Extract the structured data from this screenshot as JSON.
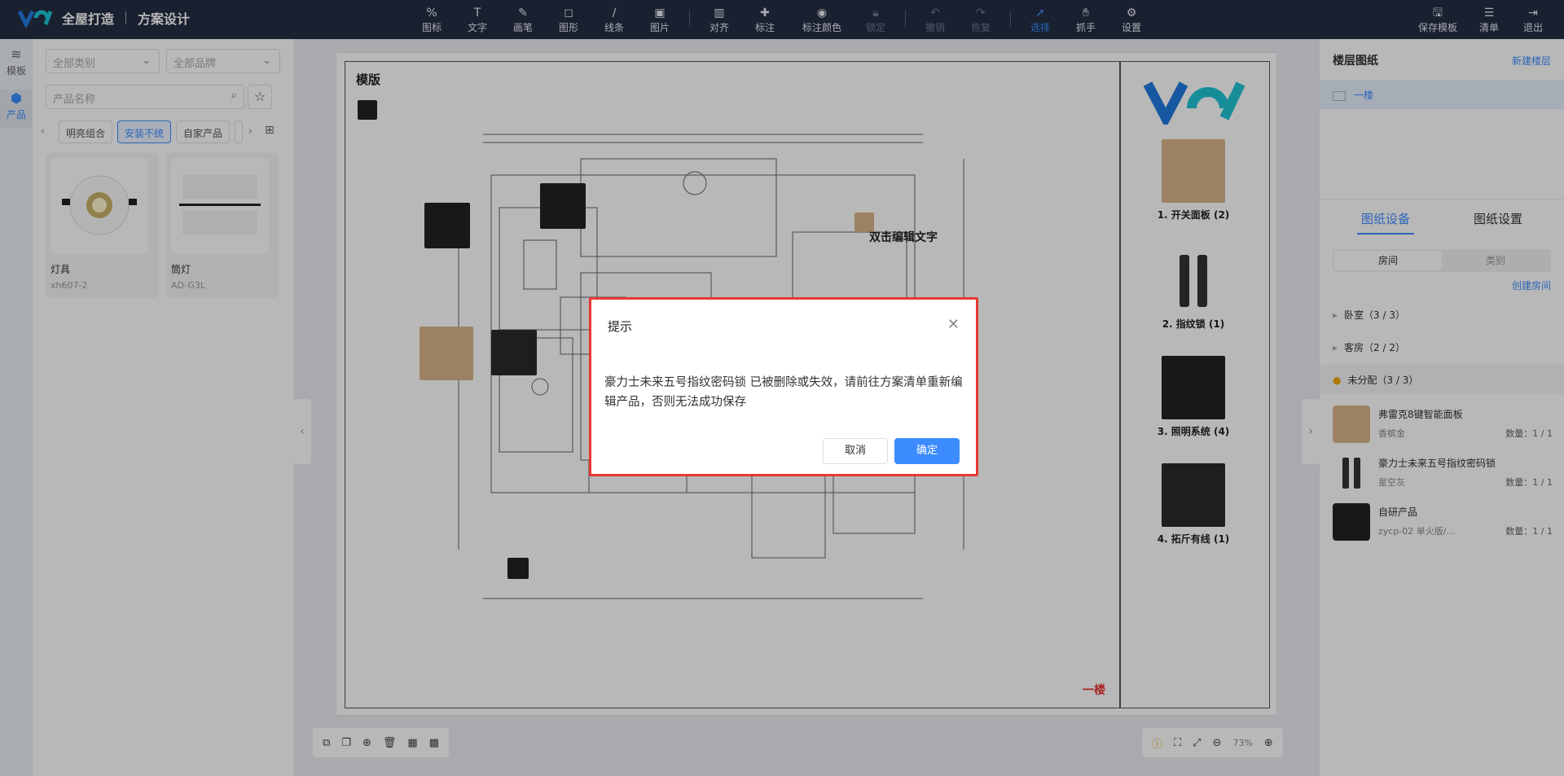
{
  "header": {
    "brand_title": "全屋打造",
    "brand_subtitle": "方案设计",
    "tools": [
      {
        "label": "图标",
        "icon": "percent-icon"
      },
      {
        "label": "文字",
        "icon": "text-icon"
      },
      {
        "label": "画笔",
        "icon": "brush-icon"
      },
      {
        "label": "图形",
        "icon": "shape-icon"
      },
      {
        "label": "线条",
        "icon": "line-icon"
      },
      {
        "label": "图片",
        "icon": "image-icon"
      },
      {
        "label": "对齐",
        "icon": "align-icon"
      },
      {
        "label": "标注",
        "icon": "pin-icon"
      },
      {
        "label": "标注颜色",
        "icon": "palette-icon"
      },
      {
        "label": "锁定",
        "icon": "lock-icon"
      },
      {
        "label": "撤销",
        "icon": "undo-icon"
      },
      {
        "label": "恢复",
        "icon": "redo-icon"
      },
      {
        "label": "选择",
        "icon": "cursor-icon"
      },
      {
        "label": "抓手",
        "icon": "hand-icon"
      },
      {
        "label": "设置",
        "icon": "gear-icon"
      }
    ],
    "save_template": "保存模板",
    "list": "清单",
    "exit": "退出"
  },
  "rail": {
    "templates": "模板",
    "products": "产品"
  },
  "left": {
    "category_placeholder": "全部类别",
    "brand_placeholder": "全部品牌",
    "search_placeholder": "产品名称",
    "tags": [
      "明亮组合",
      "安装不统",
      "自家产品"
    ],
    "cards": [
      {
        "name": "灯具",
        "sku": "xh607-2"
      },
      {
        "name": "筒灯",
        "sku": "AD-G3L"
      }
    ]
  },
  "canvas": {
    "title": "模版",
    "edit_text": "双击编辑文字",
    "floor_label": "一楼",
    "legend": [
      {
        "label": "1. 开关面板 (2)"
      },
      {
        "label": "2. 指纹锁 (1)"
      },
      {
        "label": "3. 照明系统 (4)"
      },
      {
        "label": "4. 拓斤有线 (1)"
      }
    ],
    "zoom": "73%"
  },
  "right": {
    "floor_plans_title": "楼层图纸",
    "new_floor": "新建楼层",
    "floor_item": "一楼",
    "tab_devices": "图纸设备",
    "tab_settings": "图纸设置",
    "seg_room": "房间",
    "seg_category": "类别",
    "create_room": "创建房间",
    "groups": [
      {
        "label": "卧室（3 / 3）"
      },
      {
        "label": "客房（2 / 2）"
      },
      {
        "label": "未分配（3 / 3）"
      }
    ],
    "products": [
      {
        "name": "弗雷克8键智能面板",
        "color": "香槟金",
        "qty": "数量：1 / 1"
      },
      {
        "name": "豪力士未来五号指纹密码锁",
        "color": "星空灰",
        "qty": "数量：1 / 1"
      },
      {
        "name": "自研产品",
        "color": "zycp-02 单火版/...",
        "qty": "数量：1 / 1"
      }
    ]
  },
  "modal": {
    "title": "提示",
    "message": "豪力士未来五号指纹密码锁 已被删除或失效，请前往方案清单重新编辑产品，否则无法成功保存",
    "cancel": "取消",
    "confirm": "确定"
  },
  "colors": {
    "accent": "#3c8cff",
    "header_bg": "#232d42",
    "alert_border": "#e53935"
  }
}
